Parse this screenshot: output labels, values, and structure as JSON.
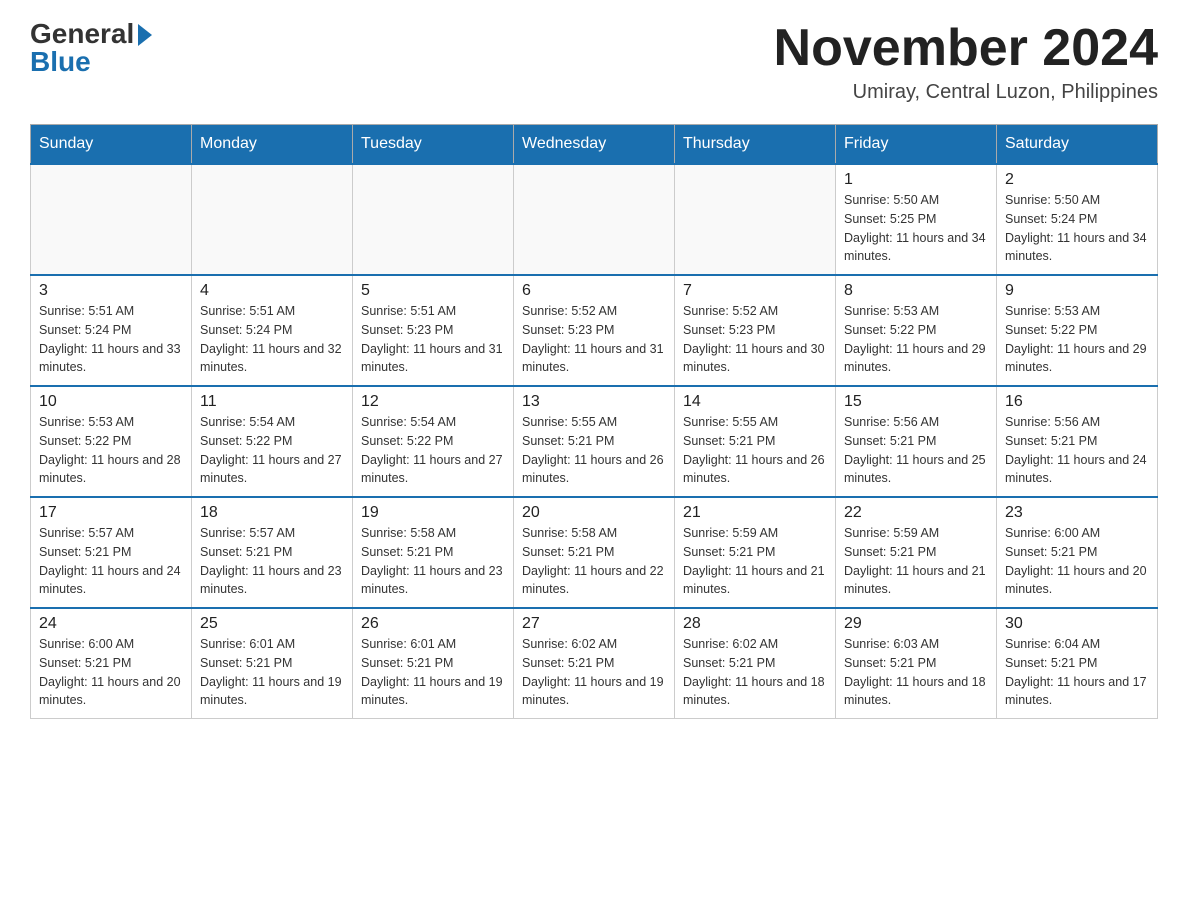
{
  "header": {
    "logo_general": "General",
    "logo_blue": "Blue",
    "month_title": "November 2024",
    "location": "Umiray, Central Luzon, Philippines"
  },
  "weekdays": [
    "Sunday",
    "Monday",
    "Tuesday",
    "Wednesday",
    "Thursday",
    "Friday",
    "Saturday"
  ],
  "weeks": [
    [
      {
        "day": "",
        "info": ""
      },
      {
        "day": "",
        "info": ""
      },
      {
        "day": "",
        "info": ""
      },
      {
        "day": "",
        "info": ""
      },
      {
        "day": "",
        "info": ""
      },
      {
        "day": "1",
        "info": "Sunrise: 5:50 AM\nSunset: 5:25 PM\nDaylight: 11 hours and 34 minutes."
      },
      {
        "day": "2",
        "info": "Sunrise: 5:50 AM\nSunset: 5:24 PM\nDaylight: 11 hours and 34 minutes."
      }
    ],
    [
      {
        "day": "3",
        "info": "Sunrise: 5:51 AM\nSunset: 5:24 PM\nDaylight: 11 hours and 33 minutes."
      },
      {
        "day": "4",
        "info": "Sunrise: 5:51 AM\nSunset: 5:24 PM\nDaylight: 11 hours and 32 minutes."
      },
      {
        "day": "5",
        "info": "Sunrise: 5:51 AM\nSunset: 5:23 PM\nDaylight: 11 hours and 31 minutes."
      },
      {
        "day": "6",
        "info": "Sunrise: 5:52 AM\nSunset: 5:23 PM\nDaylight: 11 hours and 31 minutes."
      },
      {
        "day": "7",
        "info": "Sunrise: 5:52 AM\nSunset: 5:23 PM\nDaylight: 11 hours and 30 minutes."
      },
      {
        "day": "8",
        "info": "Sunrise: 5:53 AM\nSunset: 5:22 PM\nDaylight: 11 hours and 29 minutes."
      },
      {
        "day": "9",
        "info": "Sunrise: 5:53 AM\nSunset: 5:22 PM\nDaylight: 11 hours and 29 minutes."
      }
    ],
    [
      {
        "day": "10",
        "info": "Sunrise: 5:53 AM\nSunset: 5:22 PM\nDaylight: 11 hours and 28 minutes."
      },
      {
        "day": "11",
        "info": "Sunrise: 5:54 AM\nSunset: 5:22 PM\nDaylight: 11 hours and 27 minutes."
      },
      {
        "day": "12",
        "info": "Sunrise: 5:54 AM\nSunset: 5:22 PM\nDaylight: 11 hours and 27 minutes."
      },
      {
        "day": "13",
        "info": "Sunrise: 5:55 AM\nSunset: 5:21 PM\nDaylight: 11 hours and 26 minutes."
      },
      {
        "day": "14",
        "info": "Sunrise: 5:55 AM\nSunset: 5:21 PM\nDaylight: 11 hours and 26 minutes."
      },
      {
        "day": "15",
        "info": "Sunrise: 5:56 AM\nSunset: 5:21 PM\nDaylight: 11 hours and 25 minutes."
      },
      {
        "day": "16",
        "info": "Sunrise: 5:56 AM\nSunset: 5:21 PM\nDaylight: 11 hours and 24 minutes."
      }
    ],
    [
      {
        "day": "17",
        "info": "Sunrise: 5:57 AM\nSunset: 5:21 PM\nDaylight: 11 hours and 24 minutes."
      },
      {
        "day": "18",
        "info": "Sunrise: 5:57 AM\nSunset: 5:21 PM\nDaylight: 11 hours and 23 minutes."
      },
      {
        "day": "19",
        "info": "Sunrise: 5:58 AM\nSunset: 5:21 PM\nDaylight: 11 hours and 23 minutes."
      },
      {
        "day": "20",
        "info": "Sunrise: 5:58 AM\nSunset: 5:21 PM\nDaylight: 11 hours and 22 minutes."
      },
      {
        "day": "21",
        "info": "Sunrise: 5:59 AM\nSunset: 5:21 PM\nDaylight: 11 hours and 21 minutes."
      },
      {
        "day": "22",
        "info": "Sunrise: 5:59 AM\nSunset: 5:21 PM\nDaylight: 11 hours and 21 minutes."
      },
      {
        "day": "23",
        "info": "Sunrise: 6:00 AM\nSunset: 5:21 PM\nDaylight: 11 hours and 20 minutes."
      }
    ],
    [
      {
        "day": "24",
        "info": "Sunrise: 6:00 AM\nSunset: 5:21 PM\nDaylight: 11 hours and 20 minutes."
      },
      {
        "day": "25",
        "info": "Sunrise: 6:01 AM\nSunset: 5:21 PM\nDaylight: 11 hours and 19 minutes."
      },
      {
        "day": "26",
        "info": "Sunrise: 6:01 AM\nSunset: 5:21 PM\nDaylight: 11 hours and 19 minutes."
      },
      {
        "day": "27",
        "info": "Sunrise: 6:02 AM\nSunset: 5:21 PM\nDaylight: 11 hours and 19 minutes."
      },
      {
        "day": "28",
        "info": "Sunrise: 6:02 AM\nSunset: 5:21 PM\nDaylight: 11 hours and 18 minutes."
      },
      {
        "day": "29",
        "info": "Sunrise: 6:03 AM\nSunset: 5:21 PM\nDaylight: 11 hours and 18 minutes."
      },
      {
        "day": "30",
        "info": "Sunrise: 6:04 AM\nSunset: 5:21 PM\nDaylight: 11 hours and 17 minutes."
      }
    ]
  ]
}
